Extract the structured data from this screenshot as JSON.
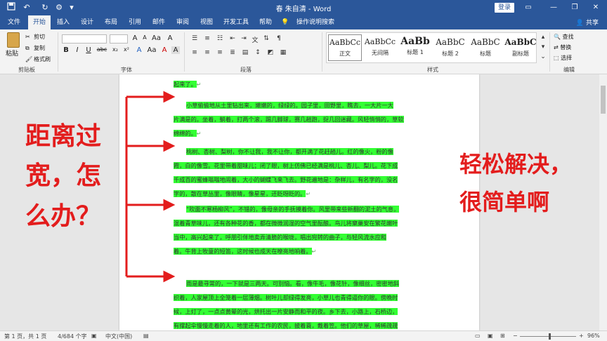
{
  "titlebar": {
    "title": "春 朱自清 - Word",
    "login": "登录",
    "icons": [
      "save-icon",
      "undo-icon",
      "redo-icon",
      "customize-icon"
    ]
  },
  "ribbon_tabs": [
    "文件",
    "开始",
    "插入",
    "设计",
    "布局",
    "引用",
    "邮件",
    "审阅",
    "视图",
    "开发工具",
    "帮助",
    "操作说明搜索"
  ],
  "share": "共享",
  "clipboard": {
    "paste": "粘贴",
    "cut": "剪切",
    "copy": "复制",
    "format_painter": "格式刷",
    "label": "剪贴板"
  },
  "font": {
    "label": "字体",
    "buttons": [
      "B",
      "I",
      "U",
      "abc",
      "x₂",
      "x²",
      "A",
      "Aa",
      "A",
      "A"
    ]
  },
  "paragraph": {
    "label": "段落"
  },
  "styles": {
    "label": "样式",
    "items": [
      {
        "preview": "AaBbCc",
        "name": "正文"
      },
      {
        "preview": "AaBbCc",
        "name": "无间隔"
      },
      {
        "preview": "AaBb",
        "name": "标题 1"
      },
      {
        "preview": "AaBbC",
        "name": "标题 2"
      },
      {
        "preview": "AaBbC",
        "name": "标题"
      },
      {
        "preview": "AaBbC",
        "name": "副标题"
      }
    ]
  },
  "editing": {
    "find": "查找",
    "replace": "替换",
    "select": "选择",
    "label": "编辑"
  },
  "document": {
    "paragraphs": [
      [
        "起来了。"
      ],
      [
        "小草偷偷地从土里钻出来，嫩嫩的，绿绿的。园子里，田野里，瞧去，一大片一大",
        "片满是的。坐着，躺着，打两个滚，踢几脚球，赛几趟跑，捉几回迷藏。风轻悄悄的，草软",
        "绵绵的。"
      ],
      [
        "桃树、杏树、梨树，你不让我，我不让你，都开满了花赶趟儿。红的像火，粉的像",
        "霞，白的像雪。花里带着甜味儿；闭了眼，树上仿佛已经满是桃儿、杏儿、梨儿。花下成",
        "千成百的蜜蜂嗡嗡地闹着，大小的蝴蝶飞来飞去。野花遍地是：杂样儿，有名字的，没名",
        "字的，散在草丛里，像眼睛，像星星，还眨呀眨的。"
      ],
      [
        "“吹面不寒杨柳风”，不错的，像母亲的手抚摸着你。风里带来些新翻的泥土的气息，",
        "混着青草味儿，还有各种花的香，都在微微润湿的空气里酝酿。鸟儿将窠巢安在繁花嫩叶",
        "当中，高兴起来了，呼朋引伴地卖弄清脆的喉咙，唱出宛转的曲子，与轻风流水应和",
        "着。牛背上牧童的短笛，这时候也成天在嘹亮地响着。"
      ],
      [
        "雨是最寻常的，一下就是三两天。可别恼。看，像牛毛，像花针，像细丝，密密地斜",
        "织着，人家屋顶上全笼着一层薄烟。树叶儿却绿得发亮，小草儿也青得逼你的眼。傍晚时",
        "候，上灯了，一点点黄晕的光，烘托出一片安静而和平的夜。乡下去，小路上，石桥边，",
        "有撑起伞慢慢走着的人，地里还有工作的农民，披着蓑，戴着笠。他们的草屋，稀稀疏疏"
      ]
    ],
    "annotation_left": [
      "距离过",
      "宽，怎",
      "么办？"
    ],
    "annotation_right": [
      "轻松解决，",
      "很简单啊"
    ]
  },
  "colors": {
    "accent": "#2b579a",
    "highlight": "#33ff33",
    "annotation": "#e31d1d"
  },
  "status": {
    "page": "第 1 页，共 1 页",
    "words": "4/684 个字",
    "language": "中文(中国)",
    "zoom": "96%",
    "zoom_fraction": 0.53
  }
}
